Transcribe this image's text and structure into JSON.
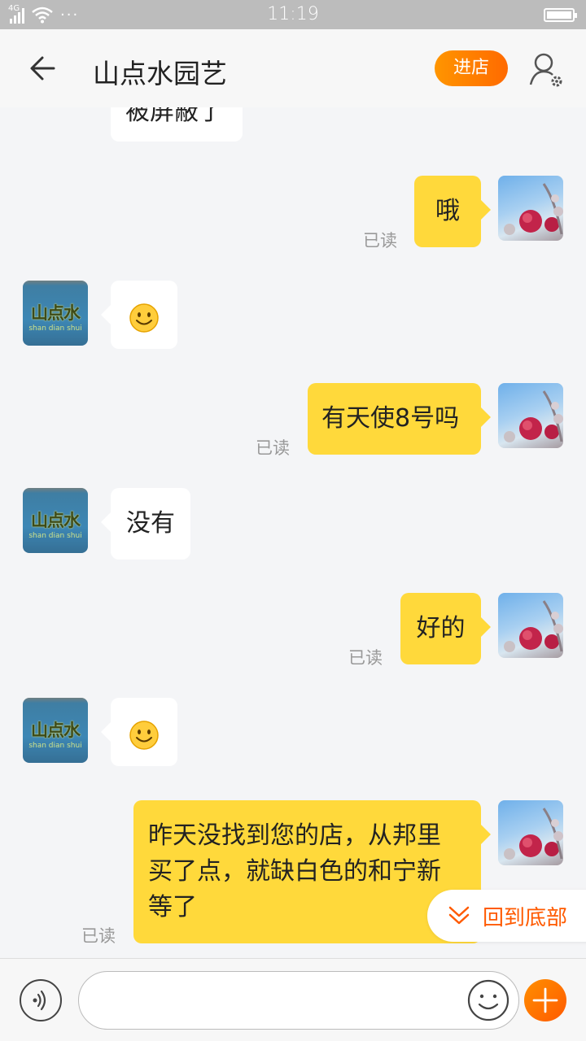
{
  "status_bar": {
    "network_label": "4G",
    "time": "11:19",
    "more_glyph": "···"
  },
  "header": {
    "title": "山点水园艺",
    "enter_store_label": "进店",
    "back_icon": "back-arrow-icon",
    "profile_icon": "user-settings-icon"
  },
  "shop_avatar": {
    "logo_text": "山点水",
    "logo_sub": "shan dian shui"
  },
  "messages": [
    {
      "sender": "shop",
      "text": "被屏蔽了"
    },
    {
      "sender": "me",
      "text": "哦",
      "status": "已读"
    },
    {
      "sender": "shop",
      "type": "emoji",
      "icon": "smiley-emoji-icon"
    },
    {
      "sender": "me",
      "text": "有天使8号吗",
      "status": "已读"
    },
    {
      "sender": "shop",
      "text": "没有"
    },
    {
      "sender": "me",
      "text": "好的",
      "status": "已读"
    },
    {
      "sender": "shop",
      "type": "emoji",
      "icon": "smiley-emoji-icon"
    },
    {
      "sender": "me",
      "text_lines": [
        "昨天没找到您的店，从邦里",
        "买了点，就缺白色的和宁新",
        "等了"
      ],
      "status": "已读"
    }
  ],
  "back_to_bottom": {
    "label": "回到底部",
    "icon": "double-chevron-down-icon"
  },
  "input_bar": {
    "voice_icon": "voice-icon",
    "input_value": "",
    "emoji_icon": "smiley-icon",
    "plus_icon": "plus-icon"
  },
  "colors": {
    "accent": "#ff6a00",
    "outgoing_bubble": "#ffd93b",
    "incoming_bubble": "#ffffff",
    "background": "#f4f5f7"
  }
}
